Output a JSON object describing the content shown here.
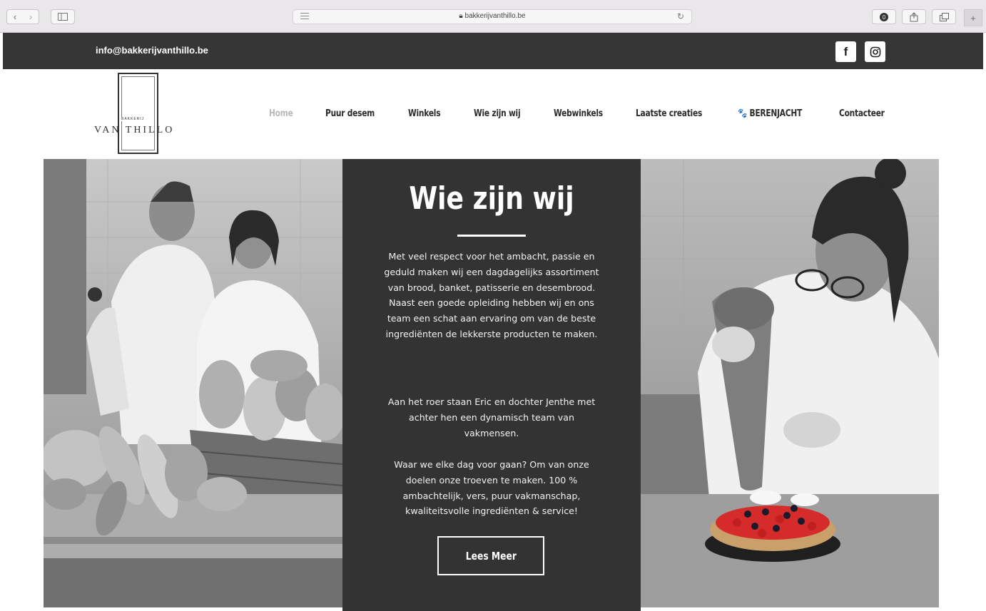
{
  "browser": {
    "url": "bakkerijvanthillo.be",
    "icons": [
      "back-icon",
      "forward-icon",
      "sidebar-icon",
      "reader-icon",
      "reload-icon",
      "extension-icon",
      "share-icon",
      "tabs-icon",
      "new-tab-icon"
    ]
  },
  "topbar": {
    "email": "info@bakkerijvanthillo.be",
    "social": [
      {
        "name": "facebook-icon",
        "glyph": "f"
      },
      {
        "name": "instagram-icon",
        "glyph": "◎"
      }
    ]
  },
  "logo": {
    "small_text": "BAKKERIJ",
    "name": "VAN THILLO"
  },
  "nav": {
    "items": [
      {
        "label": "Home",
        "active": true
      },
      {
        "label": "Puur desem",
        "active": false
      },
      {
        "label": "Winkels",
        "active": false
      },
      {
        "label": "Wie zijn wij",
        "active": false
      },
      {
        "label": "Webwinkels",
        "active": false
      },
      {
        "label": "Laatste creaties",
        "active": false
      },
      {
        "label": "🐾 BERENJACHT",
        "active": false
      },
      {
        "label": "Contacteer",
        "active": false
      }
    ]
  },
  "hero": {
    "title": "Wie zijn wij",
    "paragraphs": [
      "Met veel respect voor het ambacht, passie en geduld maken wij een dagdagelijks assortiment van brood, banket, patisserie en desembrood.  Naast een goede opleiding hebben wij en ons team een schat aan ervaring om van de beste ingrediënten de lekkerste producten te maken.",
      "Aan het roer staan Eric en dochter Jenthe met achter hen een dynamisch team van vakmensen.",
      "Waar we elke dag voor gaan? Om van onze doelen onze troeven te maken. 100 % ambachtelijk, vers, puur vakmanschap, kwaliteitsvolle ingrediënten & service!"
    ],
    "button_label": "Lees Meer"
  },
  "colors": {
    "dark": "#363636",
    "panel": "#333333",
    "nav_active": "#b9b9b9",
    "text": "#2b2b2b"
  }
}
